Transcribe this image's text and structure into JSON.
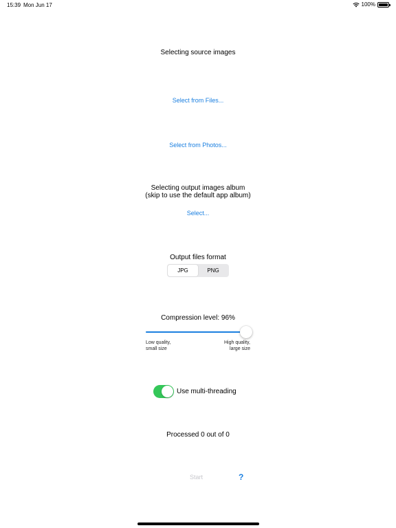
{
  "status_bar": {
    "time": "15:39",
    "date": "Mon Jun 17",
    "battery": "100%"
  },
  "source": {
    "heading": "Selecting source images",
    "files_link": "Select from Files...",
    "photos_link": "Select from Photos..."
  },
  "output_album": {
    "heading_line1": "Selecting output images album",
    "heading_line2": "(skip to use the default app album)",
    "select_link": "Select..."
  },
  "format": {
    "heading": "Output files format",
    "options": [
      "JPG",
      "PNG"
    ],
    "selected": "JPG"
  },
  "compression": {
    "label": "Compression level: 96%",
    "value": 0.96,
    "min_label_line1": "Low quality,",
    "min_label_line2": "small size",
    "max_label_line1": "High quality,",
    "max_label_line2": "large size"
  },
  "multithreading": {
    "label": "Use multi-threading",
    "enabled": true
  },
  "progress": {
    "text": "Processed 0 out of 0"
  },
  "actions": {
    "start_label": "Start",
    "help_label": "?"
  },
  "colors": {
    "accent": "#1a7fe0",
    "toggle_on": "#34c759",
    "disabled": "#c7c7cc"
  }
}
